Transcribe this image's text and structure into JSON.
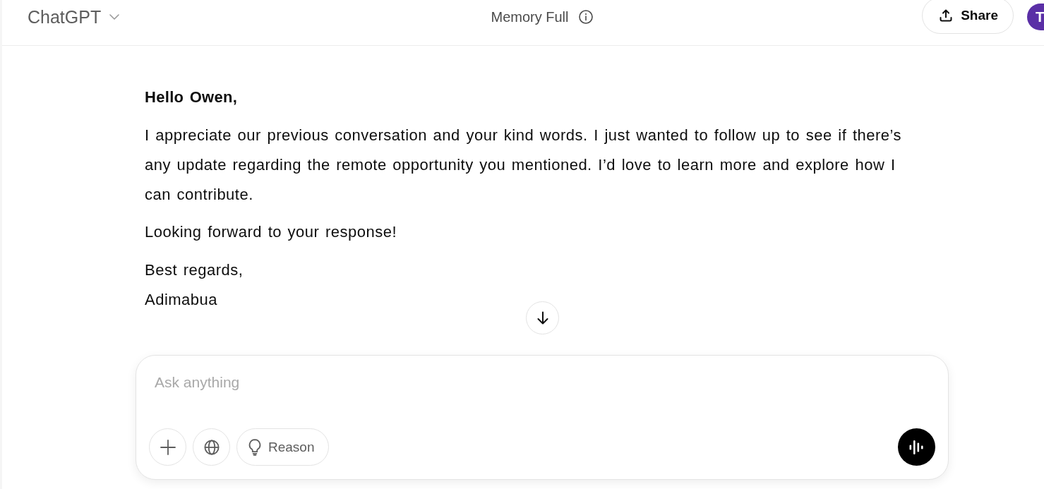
{
  "header": {
    "title": "ChatGPT",
    "memory_status": "Memory Full",
    "share_label": "Share",
    "avatar_initial": "T"
  },
  "message": {
    "greeting": "Hello Owen,",
    "paragraphs": [
      "I appreciate our previous conversation and your kind words. I just wanted to follow up to see if there’s any update regarding the remote opportunity you mentioned. I’d love to learn more and explore how I can contribute.",
      "Looking forward to your response!"
    ],
    "closing": "Best regards,",
    "signature": "Adimabua"
  },
  "composer": {
    "placeholder": "Ask anything",
    "tools": [
      {
        "kind": "add"
      },
      {
        "kind": "search"
      },
      {
        "kind": "reason",
        "label": "Reason"
      }
    ]
  }
}
